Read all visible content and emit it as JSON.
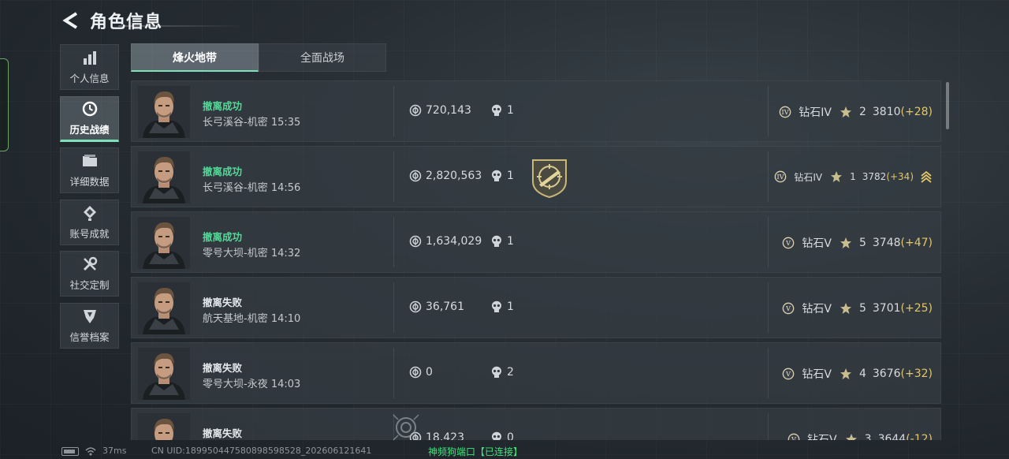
{
  "header": {
    "title": "角色信息"
  },
  "sidebar": {
    "items": [
      {
        "label": "个人信息",
        "icon": "bar-chart-icon",
        "active": false
      },
      {
        "label": "历史战绩",
        "icon": "history-clock-icon",
        "active": true
      },
      {
        "label": "详细数据",
        "icon": "folder-icon",
        "active": false
      },
      {
        "label": "账号成就",
        "icon": "achievement-icon",
        "active": false
      },
      {
        "label": "社交定制",
        "icon": "wrench-icon",
        "active": false
      },
      {
        "label": "信誉档案",
        "icon": "shield-icon",
        "active": false
      }
    ]
  },
  "tabs": [
    {
      "label": "烽火地带",
      "active": true
    },
    {
      "label": "全面战场",
      "active": false
    }
  ],
  "records": [
    {
      "status": "撤离成功",
      "map": "长弓溪谷-机密 15:35",
      "value": "720,143",
      "kills": "1",
      "tier_icon": "IV",
      "tier": "钻石IV",
      "stars": "2",
      "score": "3810",
      "delta": "(+28)",
      "small": false,
      "badge": false,
      "chevron": false
    },
    {
      "status": "撤离成功",
      "map": "长弓溪谷-机密 14:56",
      "value": "2,820,563",
      "kills": "1",
      "tier_icon": "IV",
      "tier": "钻石IV",
      "stars": "1",
      "score": "3782",
      "delta": "(+34)",
      "small": true,
      "badge": true,
      "chevron": true
    },
    {
      "status": "撤离成功",
      "map": "零号大坝-机密 14:32",
      "value": "1,634,029",
      "kills": "1",
      "tier_icon": "V",
      "tier": "钻石V",
      "stars": "5",
      "score": "3748",
      "delta": "(+47)",
      "small": false,
      "badge": false,
      "chevron": false
    },
    {
      "status": "撤离失败",
      "map": "航天基地-机密 14:10",
      "value": "36,761",
      "kills": "1",
      "tier_icon": "V",
      "tier": "钻石V",
      "stars": "5",
      "score": "3701",
      "delta": "(+25)",
      "small": false,
      "badge": false,
      "chevron": false
    },
    {
      "status": "撤离失败",
      "map": "零号大坝-永夜 14:03",
      "value": "0",
      "kills": "2",
      "tier_icon": "V",
      "tier": "钻石V",
      "stars": "4",
      "score": "3676",
      "delta": "(+32)",
      "small": false,
      "badge": false,
      "chevron": false
    },
    {
      "status": "撤离失败",
      "map": "",
      "value": "18,423",
      "kills": "0",
      "tier_icon": "V",
      "tier": "钻石V",
      "stars": "3",
      "score": "3644",
      "delta": "(-12)",
      "small": false,
      "badge": false,
      "chevron": false
    }
  ],
  "footer": {
    "ping": "37ms",
    "uid": "CN UID:189950447580898598528_202606121641",
    "connection": "神频狗端口【已连接】"
  },
  "colors": {
    "accent": "#7fe1b8",
    "success": "#4fdc96",
    "delta": "#e3c66a"
  }
}
